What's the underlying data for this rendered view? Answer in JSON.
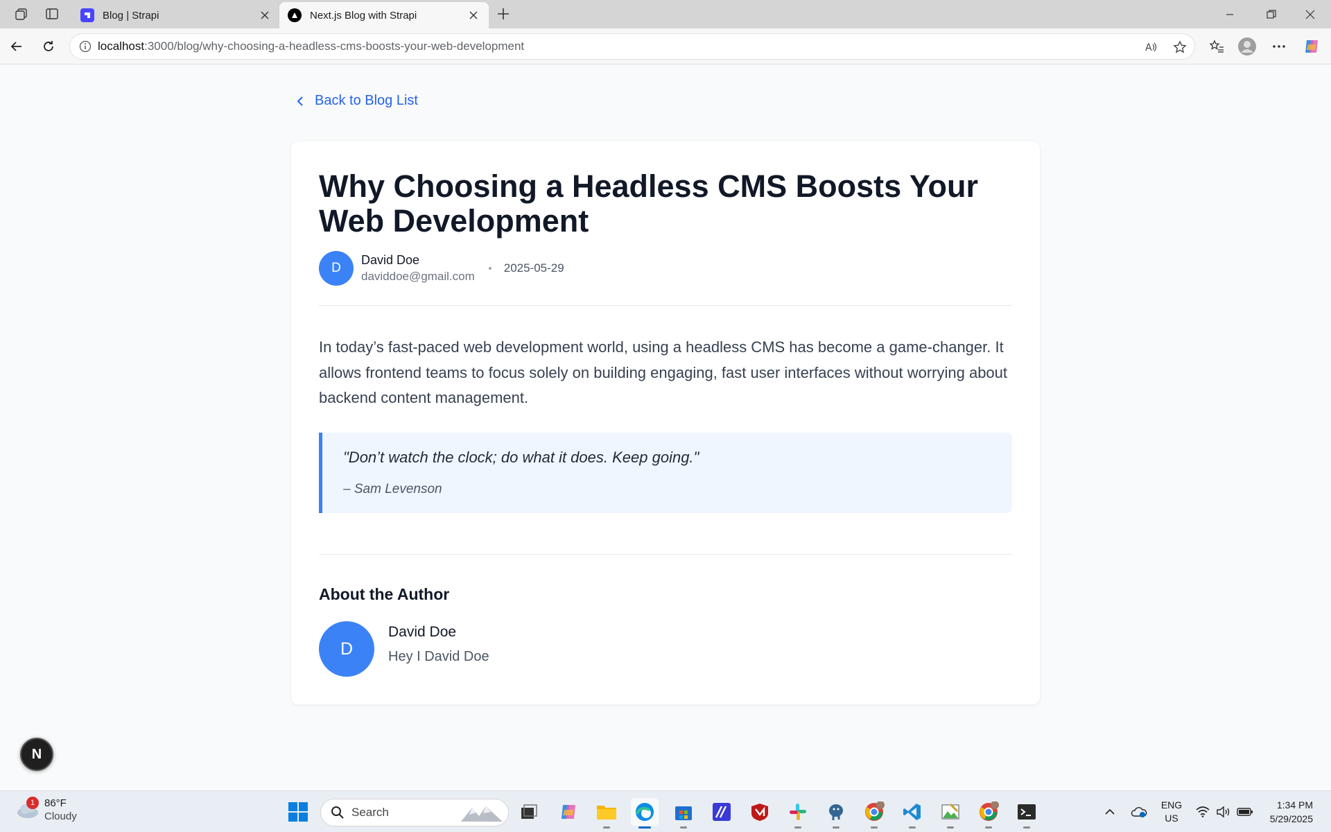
{
  "browser": {
    "tabs": [
      {
        "title": "Blog | Strapi",
        "favicon_color": "#4945ff"
      },
      {
        "title": "Next.js Blog with Strapi",
        "favicon_color": "#000000"
      }
    ],
    "url_host": "localhost",
    "url_rest": ":3000/blog/why-choosing-a-headless-cms-boosts-your-web-development"
  },
  "page": {
    "back_link": "Back to Blog List",
    "post": {
      "title": "Why Choosing a Headless CMS Boosts Your Web Development",
      "author_initial": "D",
      "author_name": "David Doe",
      "author_email": "daviddoe@gmail.com",
      "date": "2025-05-29",
      "body": "In today’s fast-paced web development world, using a headless CMS has become a game-changer. It allows frontend teams to focus solely on building engaging, fast user interfaces without worrying about backend content management.",
      "quote": "\"Don’t watch the clock; do what it does. Keep going.\"",
      "quote_author": "– Sam Levenson"
    },
    "about": {
      "heading": "About the Author",
      "initial": "D",
      "name": "David Doe",
      "bio": "Hey I David Doe"
    },
    "nextjs_badge": "N"
  },
  "colors": {
    "accent": "#2563eb",
    "avatar": "#3b82f6",
    "quote_bg": "#eff6ff"
  },
  "taskbar": {
    "weather_temp": "86°F",
    "weather_cond": "Cloudy",
    "weather_badge": "1",
    "search_label": "Search",
    "lang_top": "ENG",
    "lang_bottom": "US",
    "time": "1:34 PM",
    "date": "5/29/2025"
  }
}
